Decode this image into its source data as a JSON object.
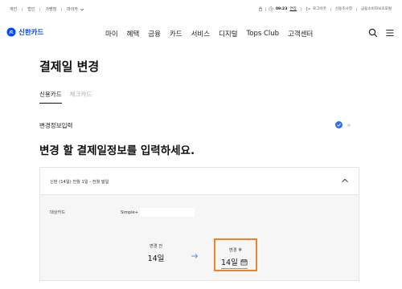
{
  "util_bar": {
    "left_links": [
      "개인",
      "법인",
      "가맹점"
    ],
    "more_label": "마이카",
    "time": "09:23",
    "extend_label": "연장",
    "logout_label": "로그아웃",
    "right_links": [
      "신용조사청",
      "금융소비자보호포털"
    ]
  },
  "header": {
    "logo_text": "신한카드",
    "nav": [
      "마이",
      "혜택",
      "금융",
      "카드",
      "서비스",
      "디지털",
      "Tops Club",
      "고객센터"
    ]
  },
  "page": {
    "title": "결제일 변경",
    "tabs": [
      "신용카드",
      "체크카드"
    ],
    "section_label": "변경정보입력",
    "headline": "변경 할 결제일정보를 입력하세요."
  },
  "card": {
    "summary": "신판 (14일) 전월 1일 - 전월 말일",
    "target_label": "대상카드",
    "target_value": "Simple+",
    "before_label": "변경 전",
    "before_value": "14일",
    "after_label": "변경 후",
    "after_value": "14일"
  },
  "colors": {
    "brand": "#0046ff",
    "highlight": "#f08227",
    "step_active": "#2a6df4"
  }
}
